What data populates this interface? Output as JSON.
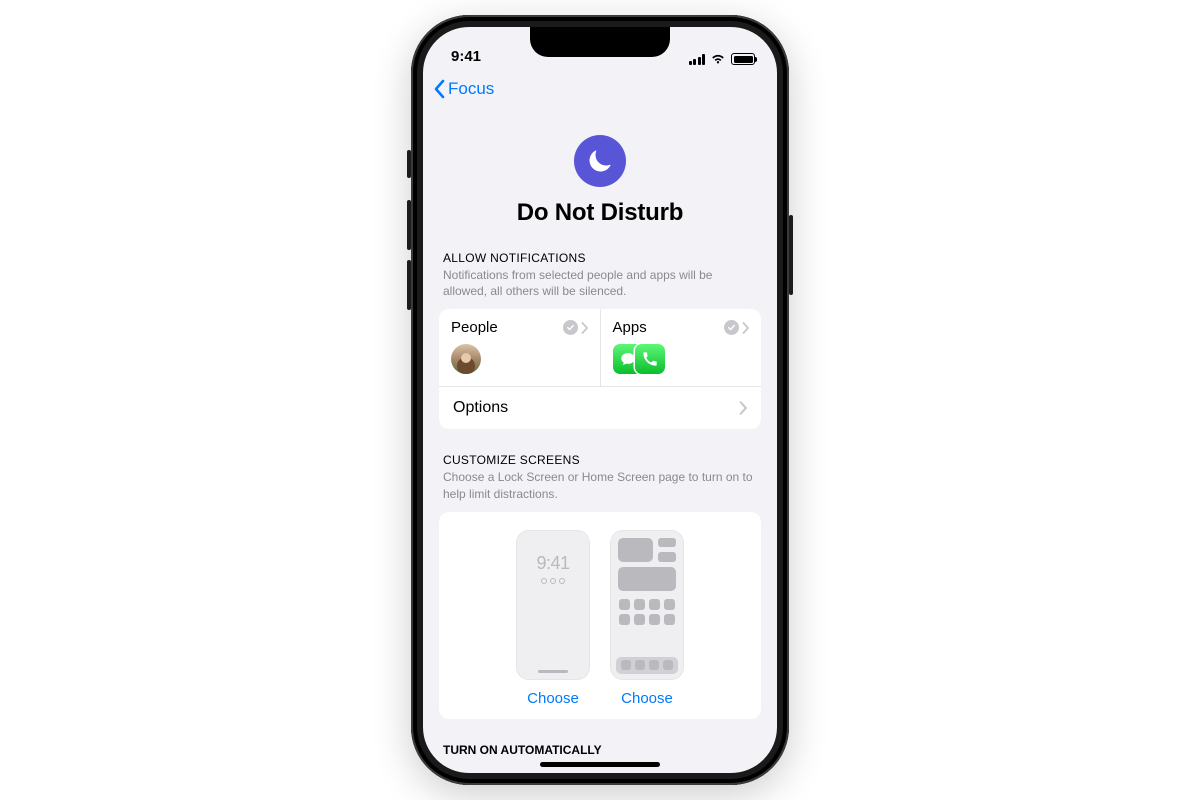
{
  "status": {
    "time": "9:41"
  },
  "nav": {
    "back_label": "Focus"
  },
  "header": {
    "title": "Do Not Disturb"
  },
  "sections": {
    "allow": {
      "header": "ALLOW NOTIFICATIONS",
      "desc": "Notifications from selected people and apps will be allowed, all others will be silenced.",
      "people_label": "People",
      "apps_label": "Apps",
      "options_label": "Options"
    },
    "customize": {
      "header": "CUSTOMIZE SCREENS",
      "desc": "Choose a Lock Screen or Home Screen page to turn on to help limit distractions.",
      "lock_time": "9:41",
      "choose_label": "Choose"
    },
    "next_header": "TURN ON AUTOMATICALLY"
  },
  "colors": {
    "tint": "#007aff",
    "dnd": "#5856d6"
  }
}
